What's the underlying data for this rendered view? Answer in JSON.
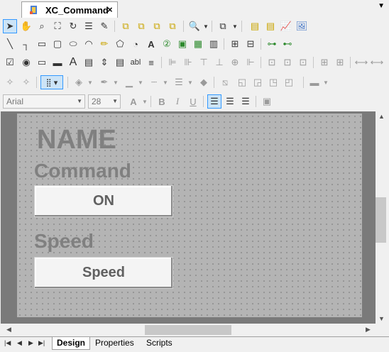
{
  "tab": {
    "title": "XC_Command",
    "close": "×"
  },
  "font_box": {
    "name": "Arial",
    "size": "28"
  },
  "canvas": {
    "name_label": "NAME",
    "command_label": "Command",
    "on_button": "ON",
    "speed_label": "Speed",
    "speed_button": "Speed"
  },
  "bottom_tabs": {
    "design": "Design",
    "properties": "Properties",
    "scripts": "Scripts"
  }
}
